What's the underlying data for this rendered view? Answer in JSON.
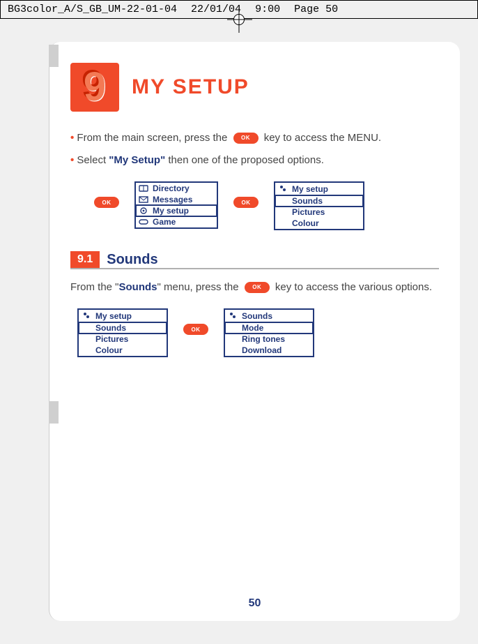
{
  "meta": {
    "docId": "BG3color_A/S_GB_UM-22-01-04",
    "date": "22/01/04",
    "time": "9:00",
    "pageLabel": "Page 50"
  },
  "chapter": {
    "number": "9",
    "title": "MY SETUP"
  },
  "intro": {
    "line1_pre": "From the main screen, press the",
    "line1_post": "key to access the MENU.",
    "line2_pre": "Select",
    "line2_bold": "\"My Setup\"",
    "line2_post": "then one of the proposed options."
  },
  "menuMain": {
    "items": [
      "Directory",
      "Messages",
      "My setup",
      "Game"
    ],
    "selectedIndex": 2
  },
  "menuMySetup": {
    "title": "My setup",
    "items": [
      "Sounds",
      "Pictures",
      "Colour"
    ],
    "selectedIndex": 0
  },
  "section": {
    "number": "9.1",
    "title": "Sounds"
  },
  "sectionText": {
    "pre": "From the \"",
    "bold": "Sounds",
    "mid": "\" menu, press the",
    "post": "key to access the various options."
  },
  "menuMySetup2": {
    "title": "My setup",
    "items": [
      "Sounds",
      "Pictures",
      "Colour"
    ],
    "selectedIndex": 0
  },
  "menuSounds": {
    "title": "Sounds",
    "items": [
      "Mode",
      "Ring tones",
      "Download"
    ],
    "selectedIndex": 0
  },
  "pageNumber": "50"
}
